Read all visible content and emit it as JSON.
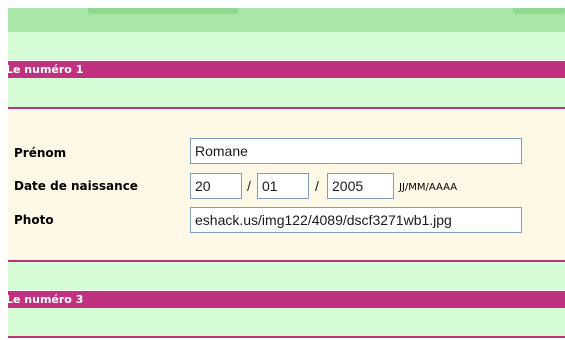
{
  "section1": {
    "title": "Le numéro 1"
  },
  "section3": {
    "title": "Le numéro 3"
  },
  "form": {
    "prenom_label": "Prénom",
    "prenom_value": "Romane",
    "birthdate_label": "Date de naissance",
    "day_value": "20",
    "month_value": "01",
    "year_value": "2005",
    "separator": "/",
    "date_format_hint": "JJ/MM/AAAA",
    "photo_label": "Photo",
    "photo_value": "eshack.us/img122/4089/dscf3271wb1.jpg"
  },
  "colors": {
    "header_magenta": "#c0327f",
    "light_green": "#d6fcd6",
    "top_green": "#a8e6a8",
    "form_cream": "#fdf9e6"
  }
}
